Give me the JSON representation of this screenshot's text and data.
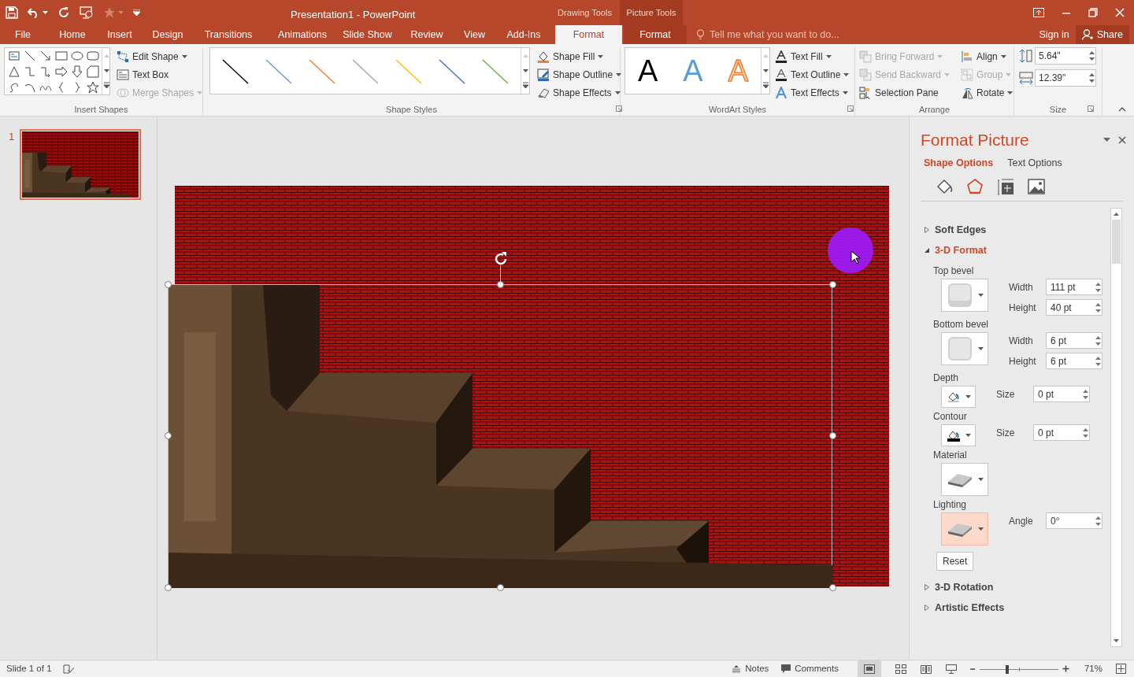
{
  "window": {
    "title": "Presentation1 - PowerPoint",
    "context_groups": [
      "Drawing Tools",
      "Picture Tools"
    ],
    "sign_in": "Sign in",
    "share": "Share"
  },
  "ribbon_tabs": [
    {
      "label": "File",
      "kind": "file",
      "selected": false
    },
    {
      "label": "Home",
      "kind": "normal",
      "selected": false
    },
    {
      "label": "Insert",
      "kind": "normal",
      "selected": false
    },
    {
      "label": "Design",
      "kind": "normal",
      "selected": false
    },
    {
      "label": "Transitions",
      "kind": "normal",
      "selected": false
    },
    {
      "label": "Animations",
      "kind": "normal",
      "selected": false
    },
    {
      "label": "Slide Show",
      "kind": "normal",
      "selected": false
    },
    {
      "label": "Review",
      "kind": "normal",
      "selected": false
    },
    {
      "label": "View",
      "kind": "normal",
      "selected": false
    },
    {
      "label": "Add-Ins",
      "kind": "normal",
      "selected": false
    },
    {
      "label": "Format",
      "kind": "context",
      "selected": true
    },
    {
      "label": "Format",
      "kind": "context-dark",
      "selected": false
    }
  ],
  "tell_me": {
    "placeholder": "Tell me what you want to do..."
  },
  "ribbon": {
    "insert_shapes": {
      "label": "Insert Shapes",
      "commands": [
        {
          "label": "Edit Shape",
          "dropdown": true,
          "disabled": false
        },
        {
          "label": "Text Box",
          "dropdown": false,
          "disabled": false
        },
        {
          "label": "Merge Shapes",
          "dropdown": true,
          "disabled": true
        }
      ]
    },
    "shape_styles": {
      "label": "Shape Styles",
      "presets": [
        {
          "color": "#000000"
        },
        {
          "color": "#5b9bd5"
        },
        {
          "color": "#ed7d31"
        },
        {
          "color": "#a5a5a5"
        },
        {
          "color": "#ffc000"
        },
        {
          "color": "#4472c4"
        },
        {
          "color": "#70ad47"
        }
      ],
      "commands": [
        {
          "label": "Shape Fill",
          "dropdown": true,
          "disabled": false
        },
        {
          "label": "Shape Outline",
          "dropdown": true,
          "disabled": false
        },
        {
          "label": "Shape Effects",
          "dropdown": true,
          "disabled": false
        }
      ]
    },
    "wordart_styles": {
      "label": "WordArt Styles",
      "presets": [
        {
          "letter": "A",
          "kind": "black"
        },
        {
          "letter": "A",
          "kind": "blue"
        },
        {
          "letter": "A",
          "kind": "orange-outline"
        }
      ],
      "commands": [
        {
          "label": "Text Fill",
          "dropdown": true,
          "disabled": false
        },
        {
          "label": "Text Outline",
          "dropdown": true,
          "disabled": false
        },
        {
          "label": "Text Effects",
          "dropdown": true,
          "disabled": false
        }
      ]
    },
    "arrange": {
      "label": "Arrange",
      "commands": [
        {
          "label": "Bring Forward",
          "dropdown": true,
          "disabled": true
        },
        {
          "label": "Send Backward",
          "dropdown": true,
          "disabled": true
        },
        {
          "label": "Selection Pane",
          "dropdown": false,
          "disabled": false
        },
        {
          "label": "Align",
          "dropdown": true,
          "disabled": false
        },
        {
          "label": "Group",
          "dropdown": true,
          "disabled": true
        },
        {
          "label": "Rotate",
          "dropdown": true,
          "disabled": false
        }
      ]
    },
    "size": {
      "label": "Size",
      "height": "5.64\"",
      "width": "12.39\""
    }
  },
  "slide_thumbnails": [
    {
      "number": "1",
      "selected": true
    }
  ],
  "format_pane": {
    "title": "Format Picture",
    "tabs": [
      {
        "label": "Shape Options",
        "selected": true
      },
      {
        "label": "Text Options",
        "selected": false
      }
    ],
    "icon_tabs": [
      {
        "selected": false
      },
      {
        "selected": true
      },
      {
        "selected": false
      },
      {
        "selected": false
      }
    ],
    "sections": [
      {
        "label": "Soft Edges",
        "expanded": false
      },
      {
        "label": "3-D Format",
        "expanded": true,
        "rows": [
          {
            "kind": "bevel",
            "label": "Top bevel",
            "hovered": false,
            "fields": [
              {
                "label": "Width",
                "value": "111 pt"
              },
              {
                "label": "Height",
                "value": "40 pt"
              }
            ]
          },
          {
            "kind": "bevel",
            "label": "Bottom bevel",
            "hovered": false,
            "fields": [
              {
                "label": "Width",
                "value": "6 pt"
              },
              {
                "label": "Height",
                "value": "6 pt"
              }
            ]
          },
          {
            "kind": "depth",
            "label": "Depth",
            "hovered": false,
            "fields": [
              {
                "label": "Size",
                "value": "0 pt"
              }
            ]
          },
          {
            "kind": "contour",
            "label": "Contour",
            "hovered": false,
            "fields": [
              {
                "label": "Size",
                "value": "0 pt"
              }
            ]
          },
          {
            "kind": "material",
            "label": "Material",
            "hovered": false
          },
          {
            "kind": "material",
            "label": "Lighting",
            "hovered": true,
            "fields": [
              {
                "label": "Angle",
                "value": "0°"
              }
            ]
          }
        ],
        "reset": "Reset"
      },
      {
        "label": "3-D Rotation",
        "expanded": false
      },
      {
        "label": "Artistic Effects",
        "expanded": false
      }
    ]
  },
  "status_bar": {
    "slide_info": "Slide 1 of 1",
    "notes": "Notes",
    "comments": "Comments",
    "zoom": {
      "level": 0.35,
      "reading": "71%"
    }
  }
}
